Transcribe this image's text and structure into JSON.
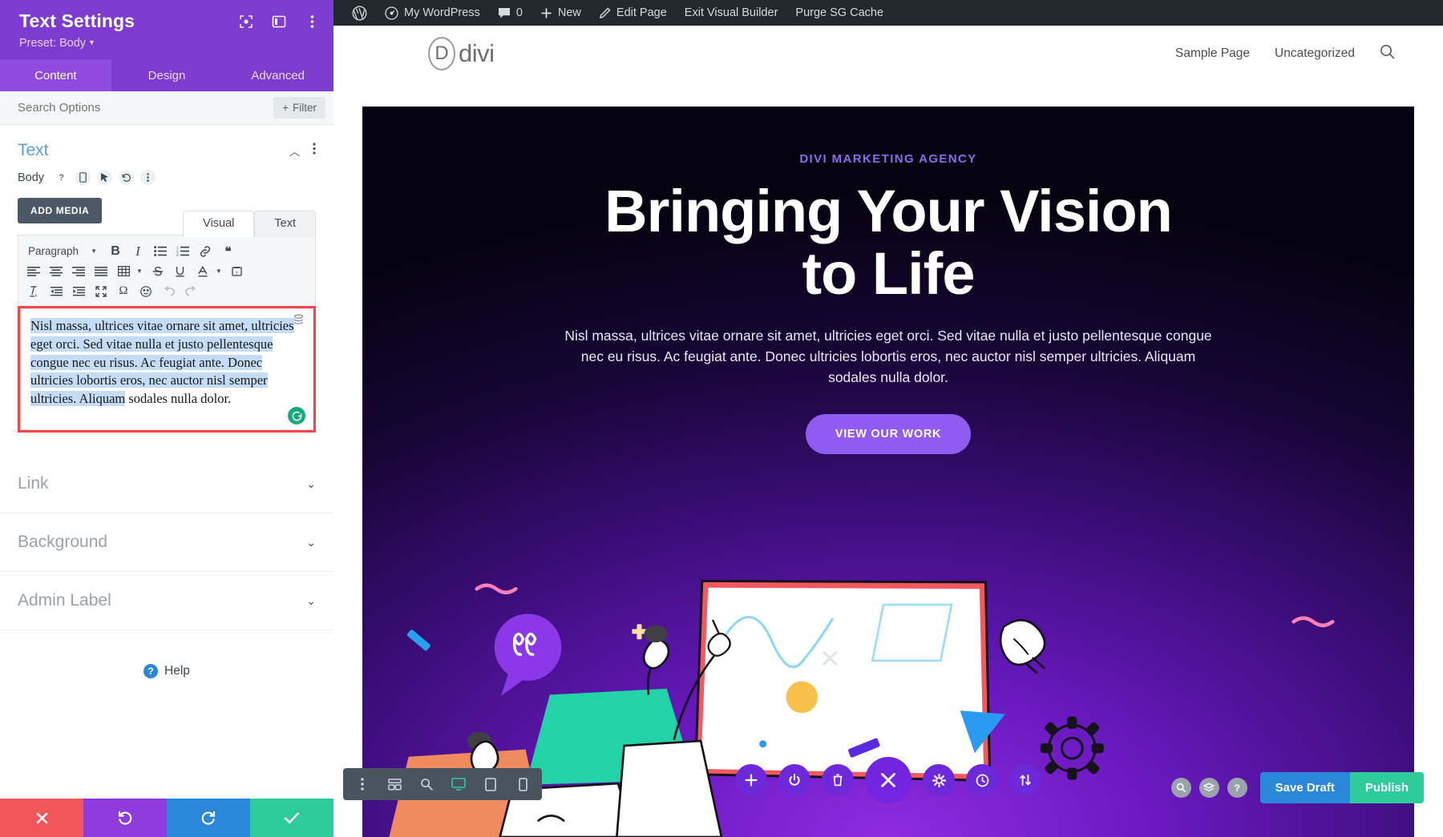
{
  "panel": {
    "title": "Text Settings",
    "preset_label": "Preset: Body",
    "header_icons": [
      "fullscreen-icon",
      "layout-columns-icon",
      "kebab-menu-icon"
    ],
    "tabs": [
      {
        "label": "Content",
        "active": true
      },
      {
        "label": "Design",
        "active": false
      },
      {
        "label": "Advanced",
        "active": false
      }
    ],
    "search_placeholder": "Search Options",
    "filter_label": "Filter",
    "section": {
      "title": "Text",
      "field_label": "Body",
      "add_media_label": "ADD MEDIA",
      "editor_tabs": [
        {
          "label": "Visual",
          "active": true
        },
        {
          "label": "Text",
          "active": false
        }
      ],
      "format_select": "Paragraph",
      "body_text_highlighted": "Nisl massa, ultrices vitae ornare sit amet, ultricies eget orci. Sed vitae nulla et justo pellentesque congue nec eu risus. Ac feugiat ante. Donec ultricies lobortis eros, nec auctor nisl semper ultricies. Aliquam",
      "body_text_tail": " sodales nulla dolor."
    },
    "collapsed_sections": [
      {
        "label": "Link"
      },
      {
        "label": "Background"
      },
      {
        "label": "Admin Label"
      }
    ],
    "help_label": "Help",
    "actions": [
      {
        "name": "discard",
        "icon": "close-icon",
        "color": "#f2555a"
      },
      {
        "name": "undo",
        "icon": "undo-icon",
        "color": "#8f3bdb"
      },
      {
        "name": "redo",
        "icon": "redo-icon",
        "color": "#2b87da"
      },
      {
        "name": "save",
        "icon": "check-icon",
        "color": "#2ecc9a"
      }
    ]
  },
  "wp_admin_bar": {
    "items": [
      {
        "label": "",
        "icon": "wordpress-logo-icon"
      },
      {
        "label": "My WordPress",
        "icon": "dashboard-icon"
      },
      {
        "label": "0",
        "icon": "comment-bubble-icon"
      },
      {
        "label": "New",
        "icon": "plus-icon"
      },
      {
        "label": "Edit Page",
        "icon": "pencil-icon"
      },
      {
        "label": "Exit Visual Builder",
        "icon": ""
      },
      {
        "label": "Purge SG Cache",
        "icon": ""
      }
    ]
  },
  "site": {
    "logo_letter": "D",
    "logo_text": "divi",
    "nav": [
      {
        "label": "Sample Page"
      },
      {
        "label": "Uncategorized"
      }
    ],
    "search_icon": "search-icon"
  },
  "hero": {
    "eyebrow": "DIVI MARKETING AGENCY",
    "heading_line1": "Bringing Your Vision",
    "heading_line2": "to Life",
    "paragraph": "Nisl massa, ultrices vitae ornare sit amet, ultricies eget orci. Sed vitae nulla et justo pellentesque congue nec eu risus. Ac feugiat ante. Donec ultricies lobortis eros, nec auctor nisl semper ultricies. Aliquam sodales nulla dolor.",
    "cta_label": "VIEW OUR WORK",
    "accent_color": "#8f5bf0",
    "eyebrow_color": "#8d6bf0"
  },
  "builder_bar": {
    "mode_buttons": [
      {
        "name": "kebab-menu-icon",
        "active": false
      },
      {
        "name": "wireframe-view-icon",
        "active": false
      },
      {
        "name": "zoom-out-view-icon",
        "active": false
      },
      {
        "name": "desktop-view-icon",
        "active": true
      },
      {
        "name": "tablet-view-icon",
        "active": false
      },
      {
        "name": "phone-view-icon",
        "active": false
      }
    ],
    "round_buttons": [
      {
        "name": "add-section-icon"
      },
      {
        "name": "power-toggle-icon"
      },
      {
        "name": "trash-icon"
      },
      {
        "name": "close-builder-icon",
        "big": true
      },
      {
        "name": "settings-gear-icon"
      },
      {
        "name": "history-clock-icon"
      },
      {
        "name": "portability-icon"
      }
    ],
    "utility_buttons": [
      {
        "name": "search-icon"
      },
      {
        "name": "layers-icon"
      },
      {
        "name": "help-icon"
      }
    ],
    "save_draft_label": "Save Draft",
    "publish_label": "Publish",
    "save_draft_color": "#2b87da",
    "publish_color": "#2ecc9a"
  }
}
